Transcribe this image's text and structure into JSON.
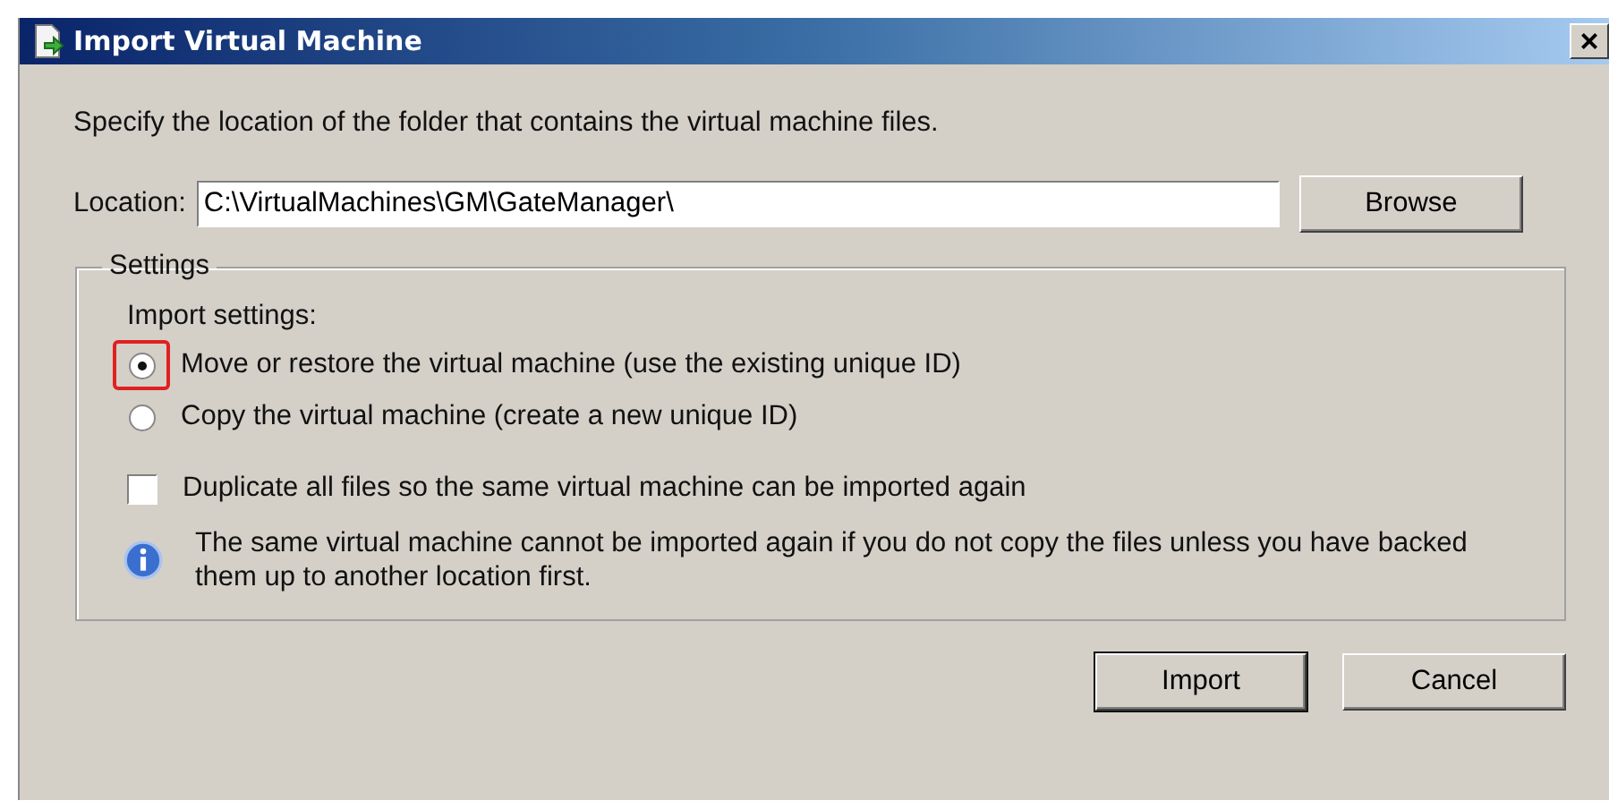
{
  "window": {
    "title": "Import Virtual Machine",
    "close": "×"
  },
  "instruction": "Specify the location of the folder that contains the virtual machine files.",
  "location": {
    "label": "Location:",
    "value": "C:\\VirtualMachines\\GM\\GateManager\\",
    "button": "Browse"
  },
  "settings": {
    "title": "Settings",
    "subtitle": "Import settings:",
    "options": [
      {
        "label": "Move or restore the virtual machine (use the existing unique ID)",
        "selected": true,
        "highlighted": true
      },
      {
        "label": "Copy the virtual machine (create a new unique ID)",
        "selected": false,
        "highlighted": false
      }
    ],
    "duplicate": {
      "label": "Duplicate all files so the same virtual machine can be imported again",
      "checked": false
    },
    "info": "The same virtual machine cannot be imported again if you do not copy the files unless you have backed them up to another location first."
  },
  "buttons": [
    {
      "label": "Import",
      "default": true
    },
    {
      "label": "Cancel",
      "default": false
    }
  ]
}
